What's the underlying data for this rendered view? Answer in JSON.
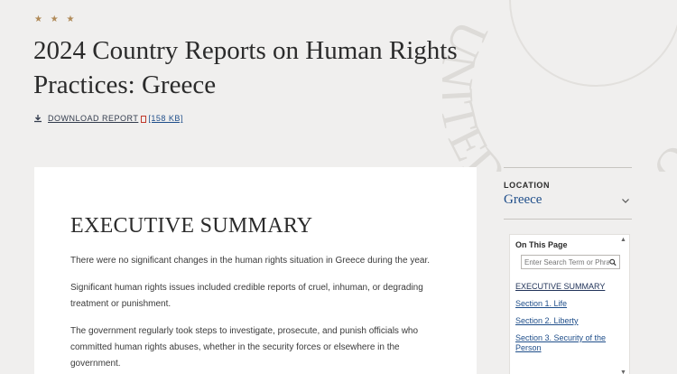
{
  "header": {
    "stars": "★ ★ ★",
    "title": "2024 Country Reports on Human Rights Practices: Greece",
    "seal_text": "UNITED STATES OF",
    "download": {
      "label": "DOWNLOAD REPORT",
      "size": "[158 KB]"
    }
  },
  "article": {
    "heading": "EXECUTIVE SUMMARY",
    "paragraphs": [
      "There were no significant changes in the human rights situation in Greece during the year.",
      "Significant human rights issues included credible reports of cruel, inhuman, or degrading treatment or punishment.",
      "The government regularly took steps to investigate, prosecute, and punish officials who committed human rights abuses, whether in the security forces or elsewhere in the government."
    ]
  },
  "sidebar": {
    "location_label": "LOCATION",
    "location_value": "Greece",
    "toc": {
      "title": "On This Page",
      "search_placeholder": "Enter Search Term or Phrase",
      "items": [
        "EXECUTIVE SUMMARY",
        "Section 1. Life",
        "Section 2. Liberty",
        "Section 3. Security of the Person"
      ]
    }
  },
  "colors": {
    "background": "#f0efee",
    "link": "#1f4e8a",
    "accent_stars": "#b08a58"
  }
}
